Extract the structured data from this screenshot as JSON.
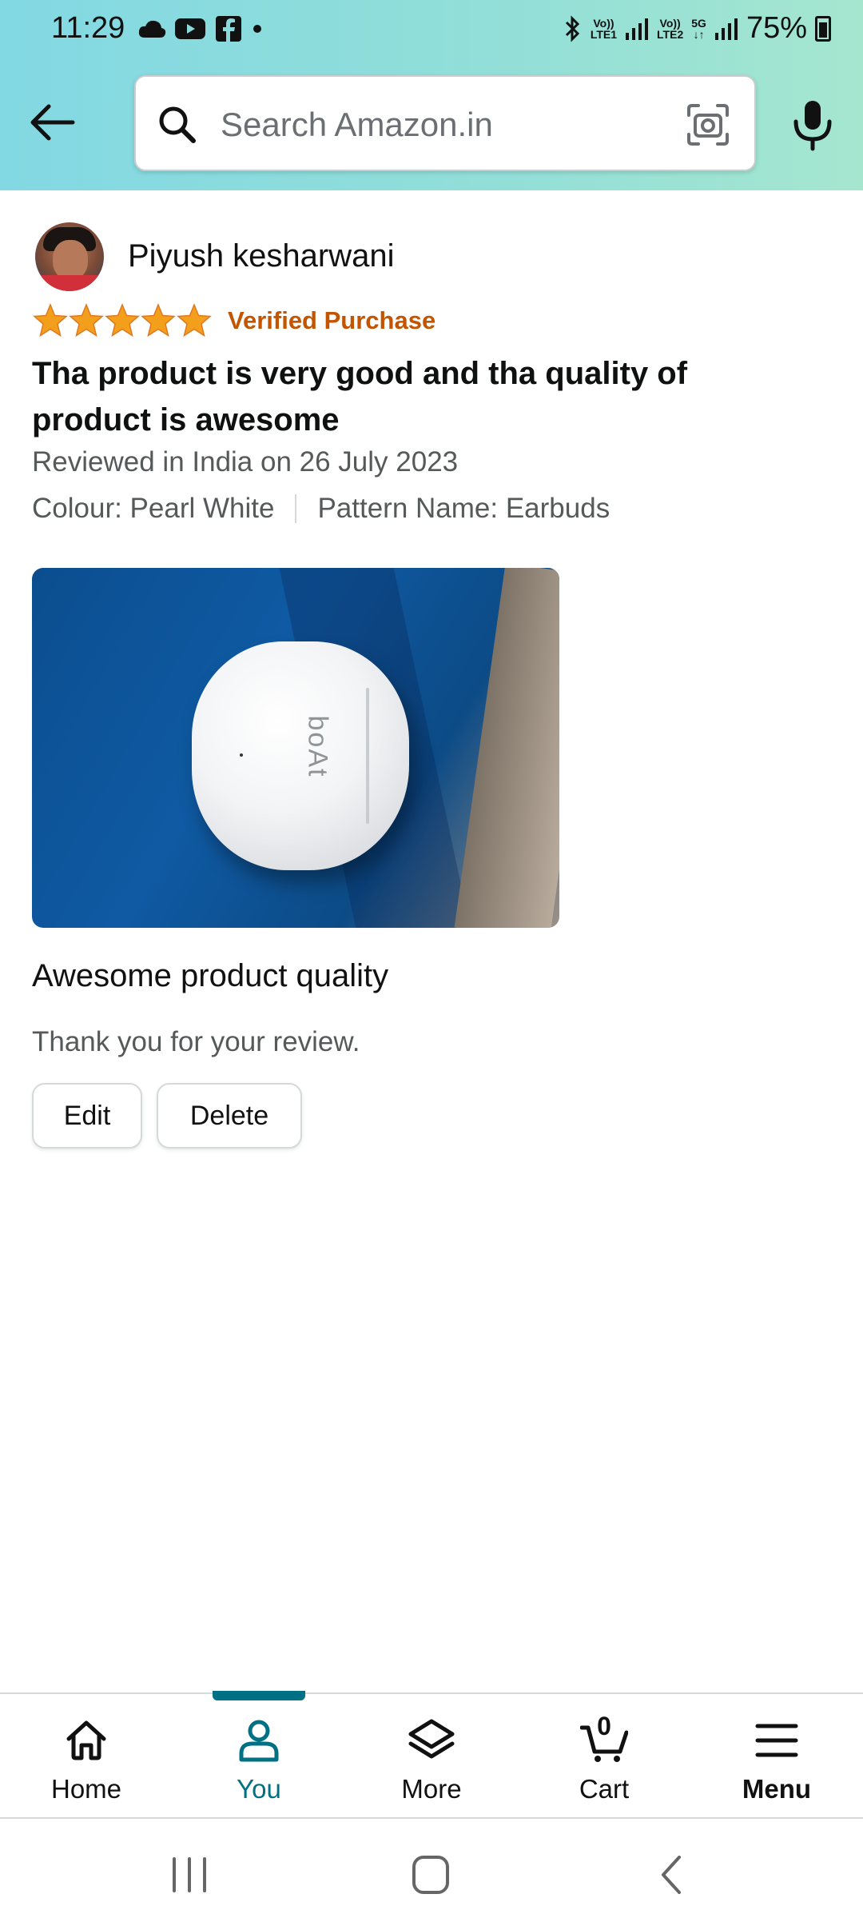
{
  "status_bar": {
    "time": "11:29",
    "battery": "75%",
    "sim1": "Vo)) LTE1",
    "sim2": "Vo)) LTE2",
    "network_5g": "5G"
  },
  "search": {
    "placeholder": "Search Amazon.in"
  },
  "review": {
    "reviewer_name": "Piyush kesharwani",
    "rating": 5,
    "rating_max": 5,
    "verified_label": "Verified Purchase",
    "title": "Tha product is very good and tha quality of product is awesome",
    "date_line": "Reviewed in India on 26 July 2023",
    "colour": "Colour: Pearl White",
    "pattern": "Pattern Name: Earbuds",
    "photo_brand": "boAt",
    "body": "Awesome product quality",
    "thanks": "Thank you for your review.",
    "edit_label": "Edit",
    "delete_label": "Delete"
  },
  "bottom_nav": {
    "items": [
      {
        "label": "Home",
        "icon": "home-icon"
      },
      {
        "label": "You",
        "icon": "user-icon",
        "active": true
      },
      {
        "label": "More",
        "icon": "layers-icon"
      },
      {
        "label": "Cart",
        "icon": "cart-icon",
        "count": "0"
      },
      {
        "label": "Menu",
        "icon": "hamburger-icon"
      }
    ]
  },
  "colors": {
    "accent": "#007185",
    "verified": "#c45500",
    "star": "#f49f1c"
  }
}
